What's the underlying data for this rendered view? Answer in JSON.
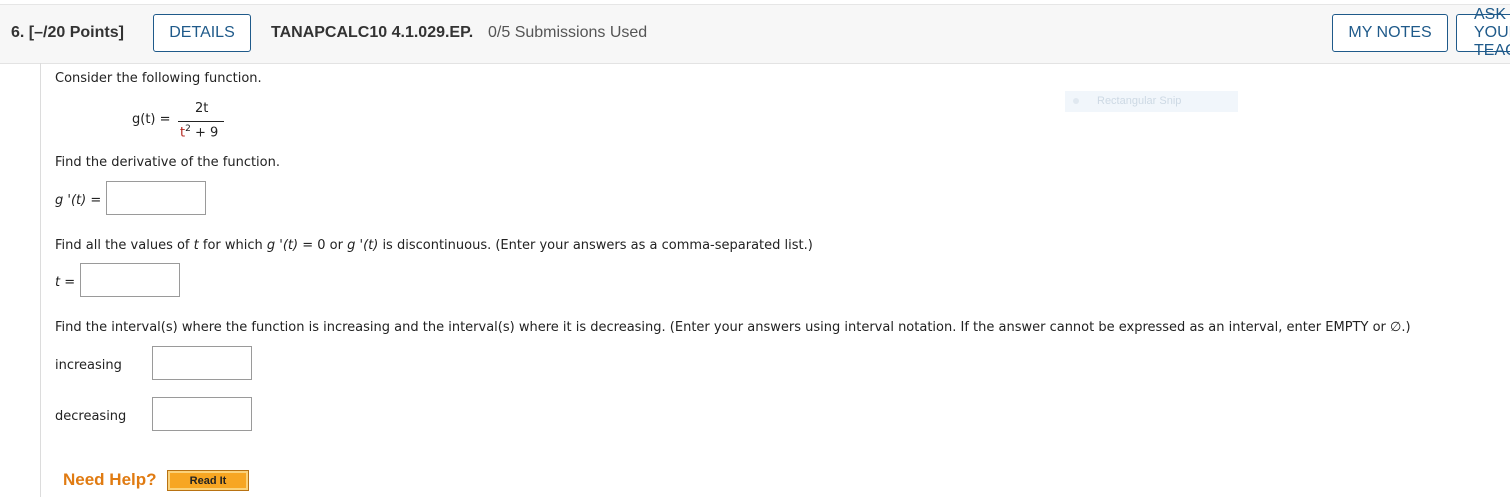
{
  "header": {
    "question_number": "6.",
    "points": "[–/20 Points]",
    "details_label": "DETAILS",
    "problem_code": "TANAPCALC10 4.1.029.EP.",
    "submissions": "0/5 Submissions Used",
    "my_notes_label": "MY NOTES",
    "ask_label": "ASK YOUR TEACHER"
  },
  "problem": {
    "intro": "Consider the following function.",
    "function_lhs": "g(t) =",
    "function_numerator": "2t",
    "function_denominator_base": "t",
    "function_denominator_exp": "2",
    "function_denominator_rest": " + 9",
    "part1_prompt": "Find the derivative of the function.",
    "part1_label": "g '(t) =",
    "part2_prompt_a": "Find all the values of ",
    "part2_prompt_var": "t",
    "part2_prompt_b": " for which ",
    "part2_prompt_c": "g '(t)",
    "part2_prompt_d": " = 0 or ",
    "part2_prompt_e": "g '(t)",
    "part2_prompt_f": " is discontinuous. (Enter your answers as a comma-separated list.)",
    "part2_label": "t =",
    "part3_prompt": "Find the interval(s) where the function is increasing and the interval(s) where it is decreasing. (Enter your answers using interval notation. If the answer cannot be expressed as an interval, enter EMPTY or ∅.)",
    "increasing_label": "increasing",
    "decreasing_label": "decreasing"
  },
  "answers": {
    "derivative": "",
    "t_values": "",
    "increasing": "",
    "decreasing": ""
  },
  "overlay": {
    "snip_label": "Rectangular Snip"
  },
  "help": {
    "need_help_label": "Need Help?",
    "read_it_label": "Read It"
  },
  "colors": {
    "button_border": "#1f5a8a",
    "help_orange": "#e07b12",
    "read_it_bg": "#f7a623",
    "denominator_red": "#b3261e"
  }
}
